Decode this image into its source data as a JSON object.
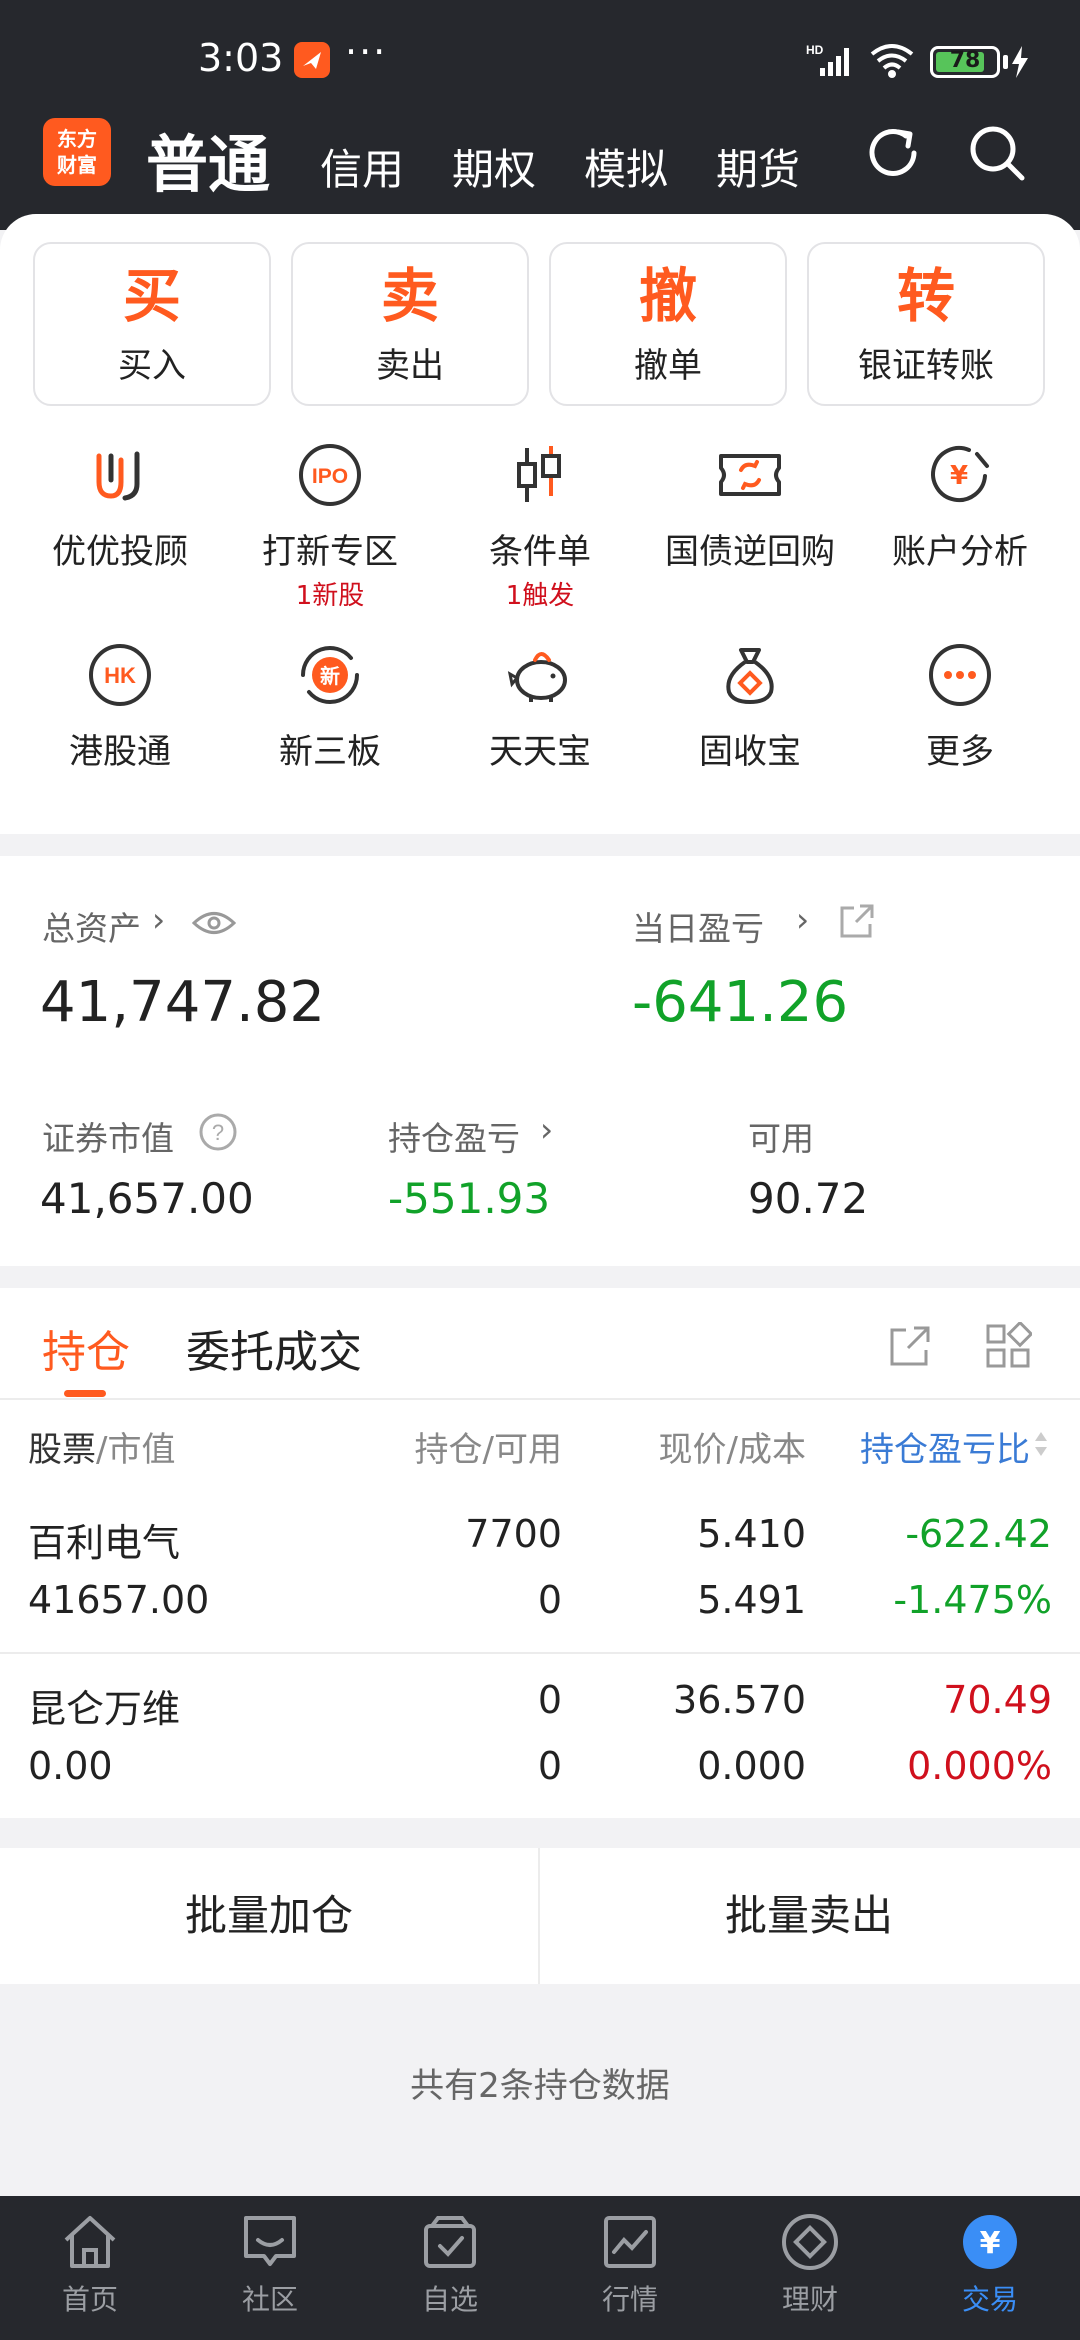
{
  "status_bar": {
    "time": "3:03",
    "network": "HD",
    "battery": "78"
  },
  "header": {
    "logo": [
      "东方",
      "财富"
    ],
    "active_tab": "普通",
    "tabs": [
      "信用",
      "期权",
      "模拟",
      "期货"
    ]
  },
  "trade_buttons": [
    {
      "big": "买",
      "label": "买入"
    },
    {
      "big": "卖",
      "label": "卖出"
    },
    {
      "big": "撤",
      "label": "撤单"
    },
    {
      "big": "转",
      "label": "银证转账"
    }
  ],
  "features_row1": [
    {
      "icon": "uu-advisor-icon",
      "label": "优优投顾",
      "sub": ""
    },
    {
      "icon": "ipo-icon",
      "label": "打新专区",
      "sub": "1新股"
    },
    {
      "icon": "candlestick-icon",
      "label": "条件单",
      "sub": "1触发"
    },
    {
      "icon": "repo-ticket-icon",
      "label": "国债逆回购",
      "sub": ""
    },
    {
      "icon": "account-analysis-icon",
      "label": "账户分析",
      "sub": ""
    }
  ],
  "features_row2": [
    {
      "icon": "hk-icon",
      "label": "港股通",
      "sub": ""
    },
    {
      "icon": "xin-icon",
      "label": "新三板",
      "sub": ""
    },
    {
      "icon": "piggy-bank-icon",
      "label": "天天宝",
      "sub": ""
    },
    {
      "icon": "money-bag-icon",
      "label": "固收宝",
      "sub": ""
    },
    {
      "icon": "more-icon",
      "label": "更多",
      "sub": ""
    }
  ],
  "assets": {
    "total_label": "总资产",
    "total_value": "41,747.82",
    "daily_pl_label": "当日盈亏",
    "daily_pl_value": "-641.26",
    "market_value_label": "证券市值",
    "market_value": "41,657.00",
    "holding_pl_label": "持仓盈亏",
    "holding_pl_value": "-551.93",
    "available_label": "可用",
    "available_value": "90.72"
  },
  "positions": {
    "tabs": [
      "持仓",
      "委托成交"
    ],
    "headers": {
      "stock": "股票",
      "market_value": "/市值",
      "holding": "持仓/可用",
      "price": "现价/成本",
      "pl": "持仓盈亏比"
    },
    "rows": [
      {
        "name": "百利电气",
        "value": "41657.00",
        "hold": "7700",
        "avail": "0",
        "price": "5.410",
        "cost": "5.491",
        "pl": "-622.42",
        "pl_pct": "-1.475%",
        "tone": "loss"
      },
      {
        "name": "昆仑万维",
        "value": "0.00",
        "hold": "0",
        "avail": "0",
        "price": "36.570",
        "cost": "0.000",
        "pl": "70.49",
        "pl_pct": "0.000%",
        "tone": "gain"
      }
    ]
  },
  "batch": {
    "add": "批量加仓",
    "sell": "批量卖出"
  },
  "count_note": "共有2条持仓数据",
  "bottom_nav": [
    {
      "icon": "home-icon",
      "label": "首页"
    },
    {
      "icon": "community-icon",
      "label": "社区"
    },
    {
      "icon": "watchlist-icon",
      "label": "自选"
    },
    {
      "icon": "market-icon",
      "label": "行情"
    },
    {
      "icon": "wealth-icon",
      "label": "理财"
    },
    {
      "icon": "trade-icon",
      "label": "交易"
    }
  ],
  "colors": {
    "accent": "#ff5a1f",
    "gain": "#d0101d",
    "loss": "#11a229",
    "nav_active": "#3a8ef6"
  }
}
